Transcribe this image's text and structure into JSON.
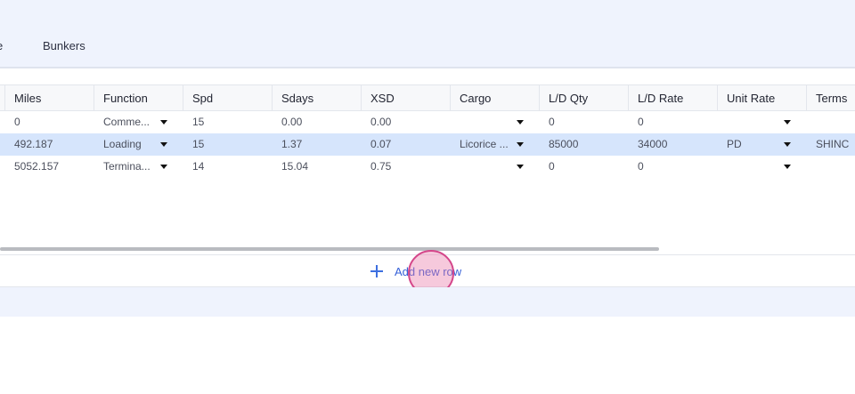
{
  "tabs": [
    {
      "label": "e"
    },
    {
      "label": "Bunkers"
    }
  ],
  "table": {
    "headers": [
      "Miles",
      "Function",
      "Spd",
      "Sdays",
      "XSD",
      "Cargo",
      "L/D Qty",
      "L/D Rate",
      "Unit Rate",
      "Terms"
    ],
    "rows": [
      {
        "miles": "0",
        "function": "Comme...",
        "spd": "15",
        "sdays": "0.00",
        "xsd": "0.00",
        "cargo": "",
        "ld_qty": "0",
        "ld_rate": "0",
        "unit_rate": "",
        "terms": ""
      },
      {
        "miles": "492.187",
        "function": "Loading",
        "spd": "15",
        "sdays": "1.37",
        "xsd": "0.07",
        "cargo": "Licorice ...",
        "ld_qty": "85000",
        "ld_rate": "34000",
        "unit_rate": "PD",
        "terms": "SHINC"
      },
      {
        "miles": "5052.157",
        "function": "Termina...",
        "spd": "14",
        "sdays": "15.04",
        "xsd": "0.75",
        "cargo": "",
        "ld_qty": "0",
        "ld_rate": "0",
        "unit_rate": "",
        "terms": ""
      }
    ],
    "selected_row_index": 1
  },
  "add_row": {
    "label": "Add new row",
    "icon": "plus-icon"
  },
  "colors": {
    "accent": "#3560d8",
    "selected_row": "#d6e5fc",
    "band": "#eff3fd"
  }
}
